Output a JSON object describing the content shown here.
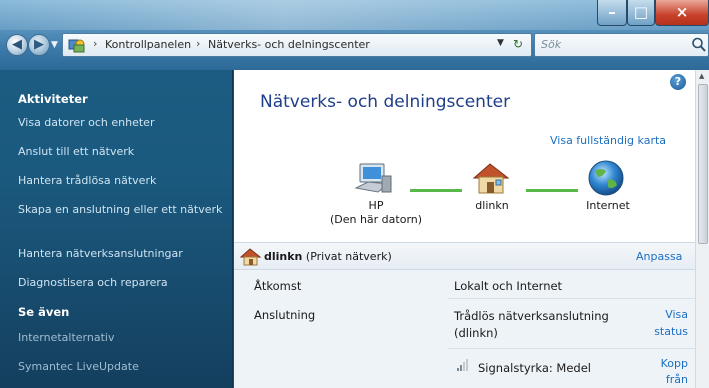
{
  "window": {
    "buttons": {
      "minimize": "–",
      "maximize": "□",
      "close": "×"
    }
  },
  "address": {
    "crumbs": [
      "Kontrollpanelen",
      "Nätverks- och delningscenter"
    ],
    "separator": "›"
  },
  "search": {
    "placeholder": "Sök"
  },
  "taskpane": {
    "tasks_title": "Aktiviteter",
    "tasks": [
      "Visa datorer och enheter",
      "Anslut till ett nätverk",
      "Hantera trådlösa nätverk",
      "Skapa en anslutning eller ett nätverk",
      "Hantera nätverksanslutningar",
      "Diagnostisera och reparera"
    ],
    "see_also_title": "Se även",
    "see_also": [
      "Internetalternativ",
      "Symantec LiveUpdate"
    ]
  },
  "main": {
    "title": "Nätverks- och delningscenter",
    "full_map_link": "Visa fullständig karta",
    "nodes": [
      {
        "label": "HP",
        "sublabel": "(Den här datorn)",
        "icon": "computer-icon"
      },
      {
        "label": "dlinkn",
        "icon": "house-icon"
      },
      {
        "label": "Internet",
        "icon": "globe-icon"
      }
    ],
    "network": {
      "name": "dlinkn",
      "type": "(Privat nätverk)",
      "adjust_link": "Anpassa"
    },
    "details": [
      {
        "label": "Åtkomst",
        "value": "Lokalt och Internet"
      },
      {
        "label": "Anslutning",
        "value_line1": "Trådlös nätverksanslutning",
        "value_line2": "(dlinkn)",
        "link_line1": "Visa",
        "link_line2": "status"
      }
    ],
    "signal": {
      "text": "Signalstyrka: Medel",
      "link_line1": "Kopp",
      "link_line2": "från"
    }
  },
  "colors": {
    "link": "#1c6fc0",
    "title": "#1e3e8a",
    "taskpane": "#1b5a7f",
    "map_line": "#58b84a"
  }
}
